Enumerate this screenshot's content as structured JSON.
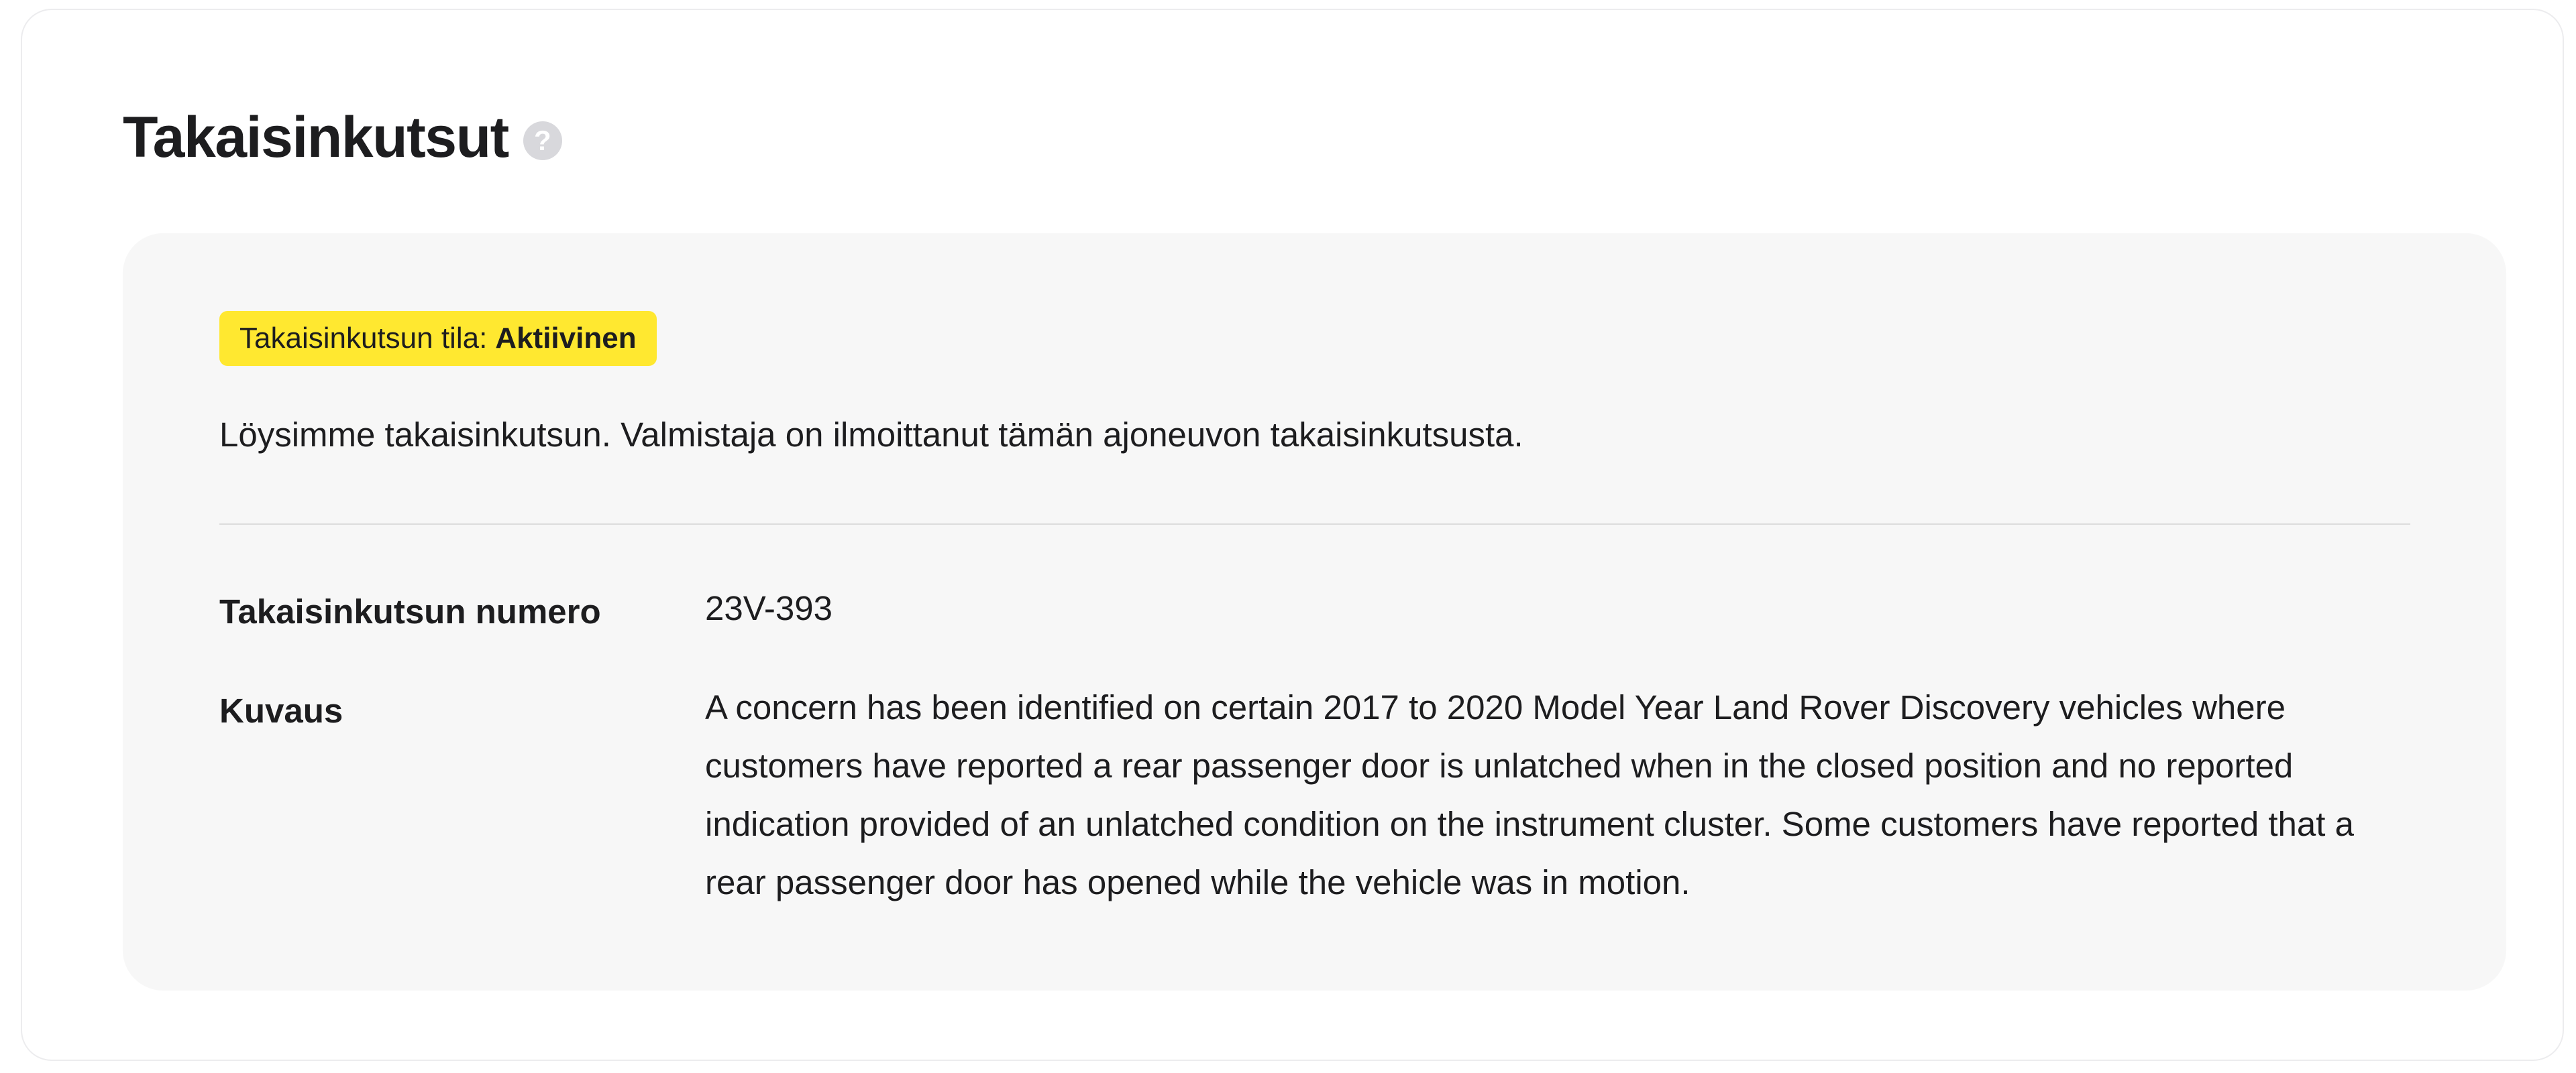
{
  "page": {
    "title": "Takaisinkutsut",
    "help_icon": "question-circle-icon"
  },
  "recall": {
    "status_label": "Takaisinkutsun tila:",
    "status_value": "Aktiivinen",
    "status_color": "#ffe830",
    "intro": "Löysimme takaisinkutsun. Valmistaja on ilmoittanut tämän ajoneuvon takaisinkutsusta.",
    "details": [
      {
        "label": "Takaisinkutsun numero",
        "value": "23V-393"
      },
      {
        "label": "Kuvaus",
        "value": "A concern has been identified on certain 2017 to 2020 Model Year Land Rover Discovery vehicles where customers have reported a rear passenger door is unlatched when in the closed position and no reported indication provided of an unlatched condition on the instrument cluster. Some customers have reported that a rear passenger door has opened while the vehicle was in motion."
      }
    ]
  }
}
